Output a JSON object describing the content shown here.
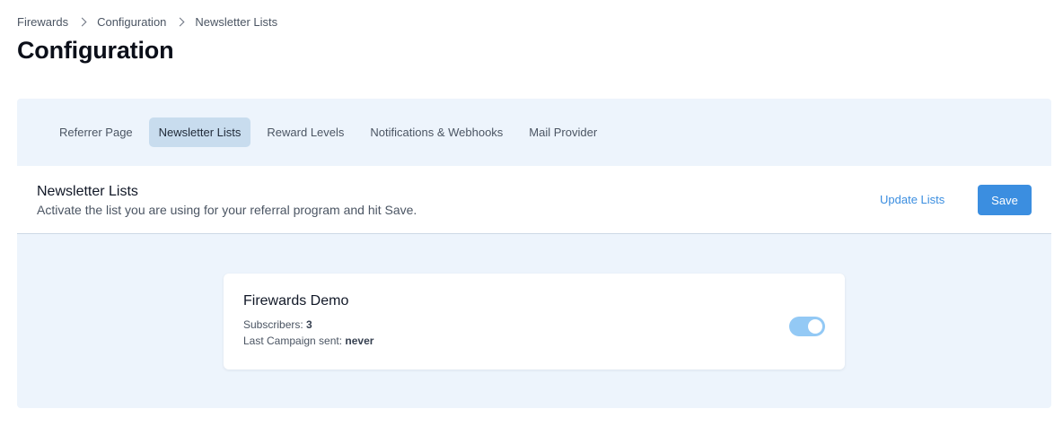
{
  "breadcrumb": {
    "items": [
      "Firewards",
      "Configuration",
      "Newsletter Lists"
    ]
  },
  "page": {
    "title": "Configuration"
  },
  "tabs": [
    {
      "label": "Referrer Page",
      "active": false
    },
    {
      "label": "Newsletter Lists",
      "active": true
    },
    {
      "label": "Reward Levels",
      "active": false
    },
    {
      "label": "Notifications & Webhooks",
      "active": false
    },
    {
      "label": "Mail Provider",
      "active": false
    }
  ],
  "section": {
    "title": "Newsletter Lists",
    "subtitle": "Activate the list you are using for your referral program and hit Save.",
    "update_label": "Update Lists",
    "save_label": "Save"
  },
  "lists": [
    {
      "name": "Firewards Demo",
      "subscribers_label": "Subscribers:",
      "subscribers": "3",
      "last_campaign_label": "Last Campaign sent:",
      "last_campaign": "never",
      "enabled": true
    }
  ],
  "colors": {
    "accent": "#3b8ee0",
    "panel_bg": "#edf4fc",
    "active_tab_bg": "#c8dcee",
    "toggle_on": "#93c9f5"
  },
  "icons": {
    "breadcrumb_separator": "chevron-right-icon"
  }
}
